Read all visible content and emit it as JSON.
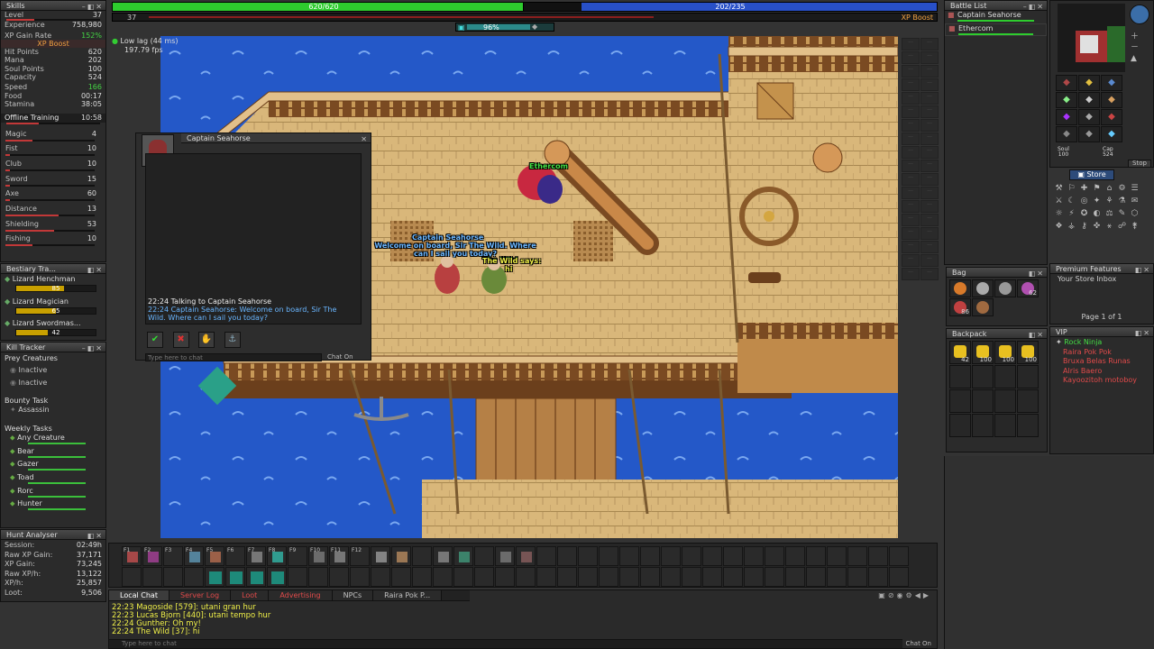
{
  "top": {
    "hp": "620/620",
    "hp_frac": 1.0,
    "mana": "202/235",
    "mana_frac": 0.86,
    "level": "37",
    "xp_boost": "XP Boost",
    "xp_frac": 0.7,
    "premium_pct": "96%"
  },
  "status": {
    "lag": "Low lag (44 ms)",
    "fps": "197.79 fps"
  },
  "skills": {
    "title": "Skills",
    "stats": [
      {
        "label": "Level",
        "value": "37",
        "bar": 0.3
      },
      {
        "label": "Experience",
        "value": "758,980"
      },
      {
        "label": "XP Gain Rate",
        "value": "152%",
        "green": true
      },
      {
        "label": "XP Boost",
        "value": ""
      },
      {
        "label": "Hit Points",
        "value": "620"
      },
      {
        "label": "Mana",
        "value": "202"
      },
      {
        "label": "Soul Points",
        "value": "100"
      },
      {
        "label": "Capacity",
        "value": "524"
      },
      {
        "label": "Speed",
        "value": "166",
        "green": true
      },
      {
        "label": "Food",
        "value": "00:17"
      },
      {
        "label": "Stamina",
        "value": "38:05"
      }
    ],
    "offline_label": "Offline Training",
    "offline_value": "10:58",
    "list": [
      {
        "label": "Magic",
        "value": "4",
        "bar": 0.3
      },
      {
        "label": "Fist",
        "value": "10",
        "bar": 0.05
      },
      {
        "label": "Club",
        "value": "10",
        "bar": 0.05
      },
      {
        "label": "Sword",
        "value": "15",
        "bar": 0.05
      },
      {
        "label": "Axe",
        "value": "60",
        "bar": 0.05
      },
      {
        "label": "Distance",
        "value": "13",
        "bar": 0.6
      },
      {
        "label": "Shielding",
        "value": "53",
        "bar": 0.55
      },
      {
        "label": "Fishing",
        "value": "10",
        "bar": 0.3
      }
    ]
  },
  "bestiary": {
    "title": "Bestiary Tra...",
    "items": [
      {
        "name": "Lizard Henchman",
        "value": "85",
        "bar": 0.6
      },
      {
        "name": "Lizard Magician",
        "value": "65",
        "bar": 0.5
      },
      {
        "name": "Lizard Swordmas...",
        "value": "42",
        "bar": 0.4
      }
    ]
  },
  "kill_tracker": {
    "title": "Kill Tracker",
    "prey_title": "Prey Creatures",
    "prey": [
      "Inactive",
      "Inactive"
    ],
    "bounty_title": "Bounty Task",
    "bounty": "Assassin",
    "weekly_title": "Weekly Tasks",
    "weekly": [
      "Any Creature",
      "Bear",
      "Gazer",
      "Toad",
      "Rorc",
      "Hunter"
    ]
  },
  "hunt": {
    "title": "Hunt Analyser",
    "rows": [
      {
        "label": "Session:",
        "value": "02:49h"
      },
      {
        "label": "Raw XP Gain:",
        "value": "37,171"
      },
      {
        "label": "XP Gain:",
        "value": "73,245"
      },
      {
        "label": "Raw XP/h:",
        "value": "13,122"
      },
      {
        "label": "XP/h:",
        "value": "25,857"
      },
      {
        "label": "Loot:",
        "value": "9,506"
      }
    ]
  },
  "npc_dialog": {
    "title": "Captain Seahorse",
    "lines": [
      "22:24 Talking to Captain Seahorse",
      "22:24 Captain Seahorse: Welcome on board, Sir The Wild. Where can I sail you today?"
    ],
    "placeholder": "Type here to chat",
    "chat_on": "Chat On"
  },
  "game_text": {
    "npc_name": "Captain Seahorse",
    "npc_speech": "Welcome on board, Sir The Wild. Where can I sail you today?",
    "player_name": "The Wild",
    "player_says": "The Wild says:",
    "player_speech": "hi",
    "other_player": "Ethercom"
  },
  "battle": {
    "title": "Battle List",
    "entries": [
      {
        "name": "Captain Seahorse",
        "hp": 1.0
      },
      {
        "name": "Ethercom",
        "hp": 1.0
      }
    ]
  },
  "equipment": {
    "soul": "Soul\n100",
    "cap": "Cap\n524",
    "stop": "Stop",
    "store": "Store"
  },
  "premium": {
    "title": "Premium Features",
    "inbox": "Your Store Inbox",
    "page": "Page 1 of 1"
  },
  "bag": {
    "title": "Bag",
    "counts": [
      "",
      "",
      "",
      "62",
      "86",
      ""
    ]
  },
  "backpack": {
    "title": "Backpack",
    "counts": [
      "42",
      "100",
      "100",
      "100"
    ]
  },
  "vip": {
    "title": "VIP",
    "online": [
      "Rock Ninja"
    ],
    "offline": [
      "Raira Pok Pok",
      "Bruxa Belas Runas",
      "Alris Baero",
      "Kayoozitoh motoboy"
    ]
  },
  "chat": {
    "tabs": [
      "Local Chat",
      "Server Log",
      "Loot",
      "Advertising",
      "NPCs",
      "Raira Pok P..."
    ],
    "lines": [
      "22:23 Magoside [579]: utani gran hur",
      "22:23 Lucas Bjorn [440]: utani tempo hur",
      "22:24 Gunther: Oh my!",
      "22:24 The Wild [37]: hi"
    ],
    "placeholder": "Type here to chat",
    "chat_on": "Chat On"
  },
  "hotkeys": {
    "labels": [
      "F1",
      "F2",
      "F3",
      "F4",
      "F5",
      "F6",
      "F7",
      "F8",
      "F9",
      "F10",
      "F11",
      "F12"
    ]
  },
  "colors": {
    "hp": "#2ecc2e",
    "mana": "#2850c8",
    "water": "#2255cc",
    "deck": "#d9b77a",
    "wood": "#7a4a22"
  }
}
